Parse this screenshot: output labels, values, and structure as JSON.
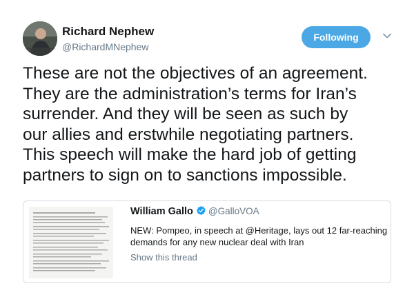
{
  "author": {
    "name": "Richard Nephew",
    "handle": "@RichardMNephew"
  },
  "follow_button": {
    "label": "Following"
  },
  "tweet": {
    "lines": [
      "These are not the objectives of an agreement.",
      "They are the administration’s terms for Iran’s",
      "surrender. And they will be seen as such by",
      "our allies and erstwhile negotiating partners.",
      "This speech will make the hard job of getting",
      "partners to sign on to sanctions impossible."
    ]
  },
  "quoted_tweet": {
    "name": "William Gallo",
    "handle": "@GalloVOA",
    "text_lines": [
      "NEW: Pompeo, in speech at @Heritage, lays out 12 far-reaching",
      "demands for any new nuclear deal with Iran"
    ],
    "show_thread": "Show this thread"
  },
  "colors": {
    "follow_button_bg": "#4ba8e4",
    "verified_badge": "#1da1f2",
    "secondary_text": "#657786"
  },
  "icons": {
    "caret": "chevron-down-icon",
    "verified": "verified-badge-icon"
  }
}
